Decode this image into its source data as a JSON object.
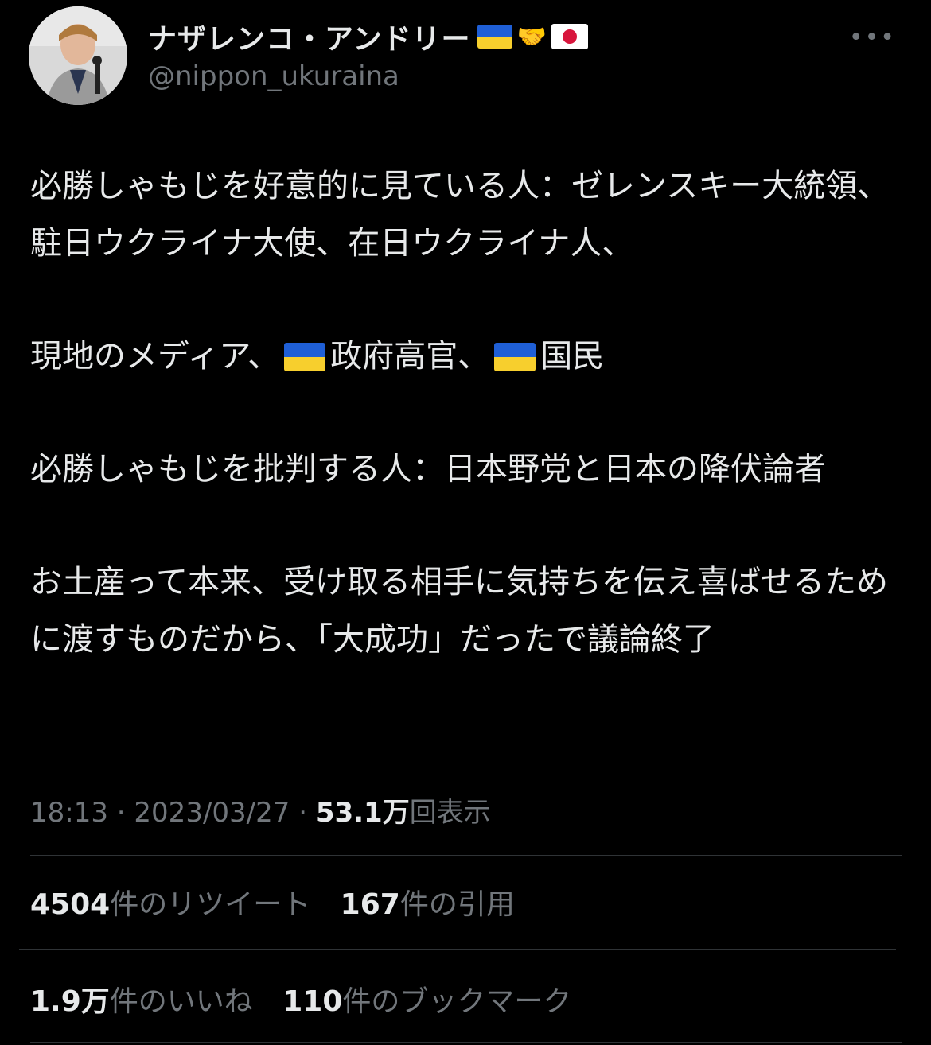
{
  "author": {
    "display_name": "ナザレンコ・アンドリー",
    "emoji": [
      "ukraine-flag",
      "handshake",
      "japan-flag"
    ],
    "handle": "@nippon_ukuraina"
  },
  "more_label": "•••",
  "tweet": {
    "p1_a": "必勝しゃもじを好意的に見ている人：ゼレンスキー大統領、駐日ウクライナ大使、在日ウクライナ人、",
    "p1_b": "現地のメディア、",
    "p1_c": "政府高官、",
    "p1_d": "国民",
    "p2": "必勝しゃもじを批判する人：日本野党と日本の降伏論者",
    "p3": "お土産って本来、受け取る相手に気持ちを伝え喜ばせるために渡すものだから、「大成功」だったで議論終了"
  },
  "meta": {
    "time": "18:13",
    "sep": "·",
    "date": "2023/03/27",
    "views_num": "53.1万",
    "views_label": "回表示"
  },
  "stats": {
    "retweets_num": "4504",
    "retweets_label": "件のリツイート",
    "quotes_num": "167",
    "quotes_label": "件の引用",
    "likes_num": "1.9万",
    "likes_label": "件のいいね",
    "bookmarks_num": "110",
    "bookmarks_label": "件のブックマーク"
  },
  "colors": {
    "background": "#000000",
    "text": "#e7e9ea",
    "secondary": "#71767b",
    "divider": "#2f3336",
    "ukraine_blue": "#1f5fd6",
    "ukraine_yellow": "#f7cf2d"
  }
}
